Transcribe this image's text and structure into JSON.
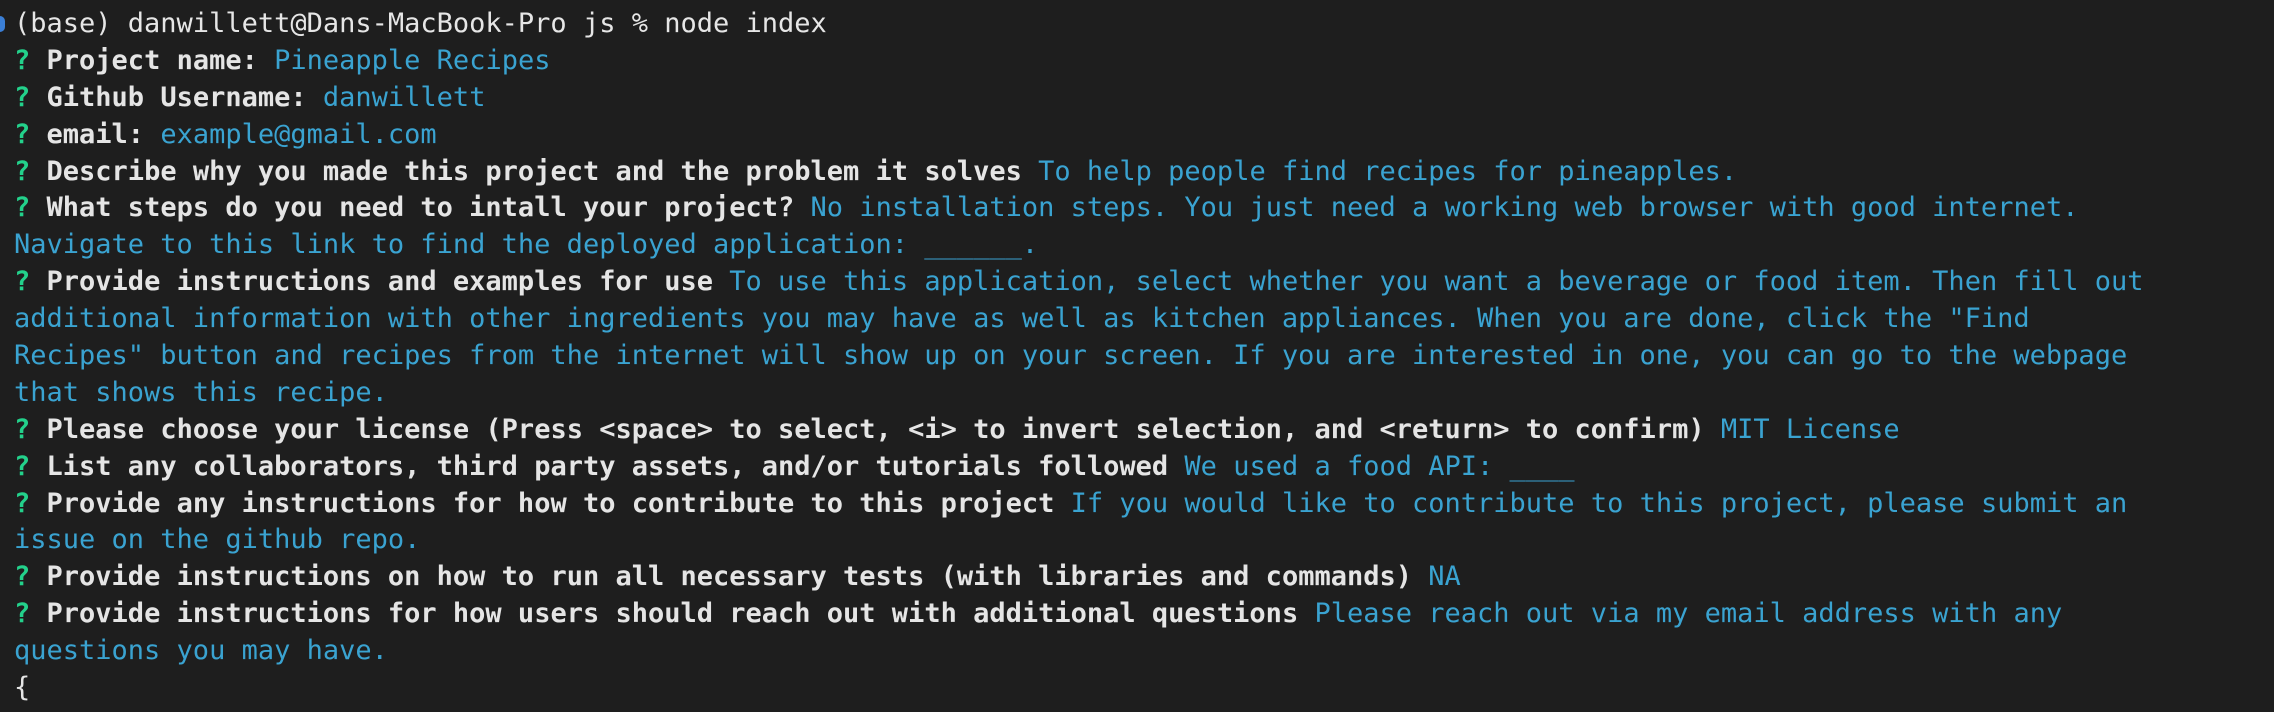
{
  "terminal": {
    "shell_prompt": "(base) danwillett@Dans-MacBook-Pro js % node index",
    "question_mark": "?",
    "entries": [
      {
        "label": "Project name:",
        "answer": "Pineapple Recipes"
      },
      {
        "label": "Github Username:",
        "answer": "danwillett"
      },
      {
        "label": "email:",
        "answer": "example@gmail.com"
      },
      {
        "label": "Describe why you made this project and the problem it solves",
        "answer": "To help people find recipes for pineapples."
      },
      {
        "label": "What steps do you need to intall your project?",
        "answer": "No installation steps. You just need a working web browser with good internet.",
        "continuation": "Navigate to this link to find the deployed application: ______."
      },
      {
        "label": "Provide instructions and examples for use",
        "answer": "To use this application, select whether you want a beverage or food item. Then fill out",
        "continuation": "additional information with other ingredients you may have as well as kitchen appliances. When you are done, click the \"Find",
        "continuation2": "Recipes\" button and recipes from the internet will show up on your screen. If you are interested in one, you can go to the webpage",
        "continuation3": "that shows this recipe."
      },
      {
        "label": "Please choose your license (Press <space> to select, <i> to invert selection, and <return> to confirm)",
        "answer": "MIT License"
      },
      {
        "label": "List any collaborators, third party assets, and/or tutorials followed",
        "answer": "We used a food API: ____"
      },
      {
        "label": "Provide any instructions for how to contribute to this project",
        "answer": "If you would like to contribute to this project, please submit an",
        "continuation": "issue on the github repo."
      },
      {
        "label": "Provide instructions on how to run all necessary tests (with libraries and commands)",
        "answer": "NA"
      },
      {
        "label": "Provide instructions for how users should reach out with additional questions",
        "answer": "Please reach out via my email address with any",
        "continuation": "questions you may have."
      }
    ],
    "trailing_output": "{"
  },
  "colors": {
    "background": "#1e1e1e",
    "question_mark": "#23d18b",
    "label": "#e5e5e5",
    "answer": "#3aa3d1"
  }
}
